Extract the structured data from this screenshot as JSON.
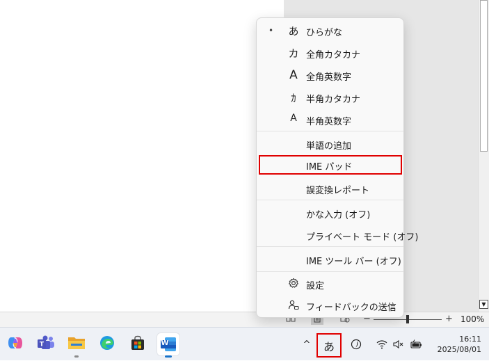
{
  "ime_menu": {
    "input_modes": [
      {
        "glyph": "あ",
        "label": "ひらがな",
        "selected": true
      },
      {
        "glyph": "カ",
        "label": "全角カタカナ",
        "selected": false
      },
      {
        "glyph": "A",
        "label": "全角英数字",
        "selected": false
      },
      {
        "glyph": "ｶ",
        "label": "半角カタカナ",
        "selected": false
      },
      {
        "glyph": "A",
        "label": "半角英数字",
        "selected": false
      }
    ],
    "tools": [
      {
        "label": "単語の追加"
      },
      {
        "label": "IME パッド",
        "highlighted": true
      },
      {
        "label": "誤変換レポート"
      }
    ],
    "toggles": [
      {
        "label": "かな入力 (オフ)"
      },
      {
        "label": "プライベート モード (オフ)"
      }
    ],
    "toolbar": {
      "label": "IME ツール バー (オフ)"
    },
    "footer": [
      {
        "icon": "gear-icon",
        "label": "設定"
      },
      {
        "icon": "person-feedback-icon",
        "label": "フィードバックの送信"
      }
    ],
    "bullet": "•",
    "highlight_color": "#e00000"
  },
  "status_bar": {
    "zoom_minus": "−",
    "zoom_plus": "+",
    "zoom_level": "100%",
    "scroll_down": "▼"
  },
  "taskbar": {
    "apps": [
      "copilot-icon",
      "teams-icon",
      "file-explorer-icon",
      "edge-icon",
      "store-icon",
      "word-icon"
    ],
    "word_label": "W",
    "tray": {
      "chevron": "^",
      "ime_indicator": "あ",
      "ime_highlight_color": "#e00000"
    },
    "clock": {
      "time": "16:11",
      "date": "2025/08/01"
    }
  }
}
